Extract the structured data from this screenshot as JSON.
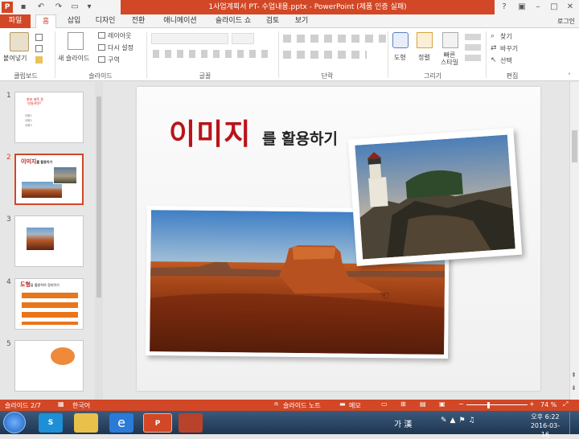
{
  "window": {
    "title": "1사업계획서 PT- 수업내용.pptx -  PowerPoint (제품 인증 실패)",
    "help": "?",
    "signin": "로그인"
  },
  "tabs": [
    "파일",
    "홈",
    "삽입",
    "디자인",
    "전환",
    "애니메이션",
    "슬라이드 쇼",
    "검토",
    "보기"
  ],
  "ribbon": {
    "clipboard": {
      "paste": "붙여넣기",
      "label": "클립보드"
    },
    "slides": {
      "new_slide": "새 슬라이드",
      "layout": "레이아웃",
      "reset": "다시 설정",
      "section": "구역",
      "label": "슬라이드"
    },
    "font": {
      "label": "글꼴"
    },
    "paragraph": {
      "label": "단락"
    },
    "drawing": {
      "shapes": "도형",
      "arrange": "정렬",
      "quick_styles": "빠른\n스타일",
      "label": "그리기"
    },
    "editing": {
      "find": "찾기",
      "replace": "바꾸기",
      "select": "선택",
      "label": "편집"
    }
  },
  "thumbnails": [
    {
      "num": "1",
      "title": "발표 제목 잘\n 만들려면?",
      "bullets": [
        "내용1",
        "내용2",
        "내용3"
      ]
    },
    {
      "num": "2",
      "title_red": "이미지",
      "title_rest": "를 활용하기"
    },
    {
      "num": "3"
    },
    {
      "num": "4",
      "title_red": "도형",
      "title_rest": "을 활용하여 정리하기"
    },
    {
      "num": "5"
    }
  ],
  "slide": {
    "title_red": "이미지",
    "title_rest": "를 활용하기"
  },
  "status": {
    "slide_of": "슬라이드 2/7",
    "language": "한국어",
    "notes": "슬라이드 노트",
    "comments": "메모",
    "zoom": "74 %"
  },
  "taskbar": {
    "ime": "가 漢",
    "time": "오후 6:22",
    "date": "2016-03-16"
  }
}
